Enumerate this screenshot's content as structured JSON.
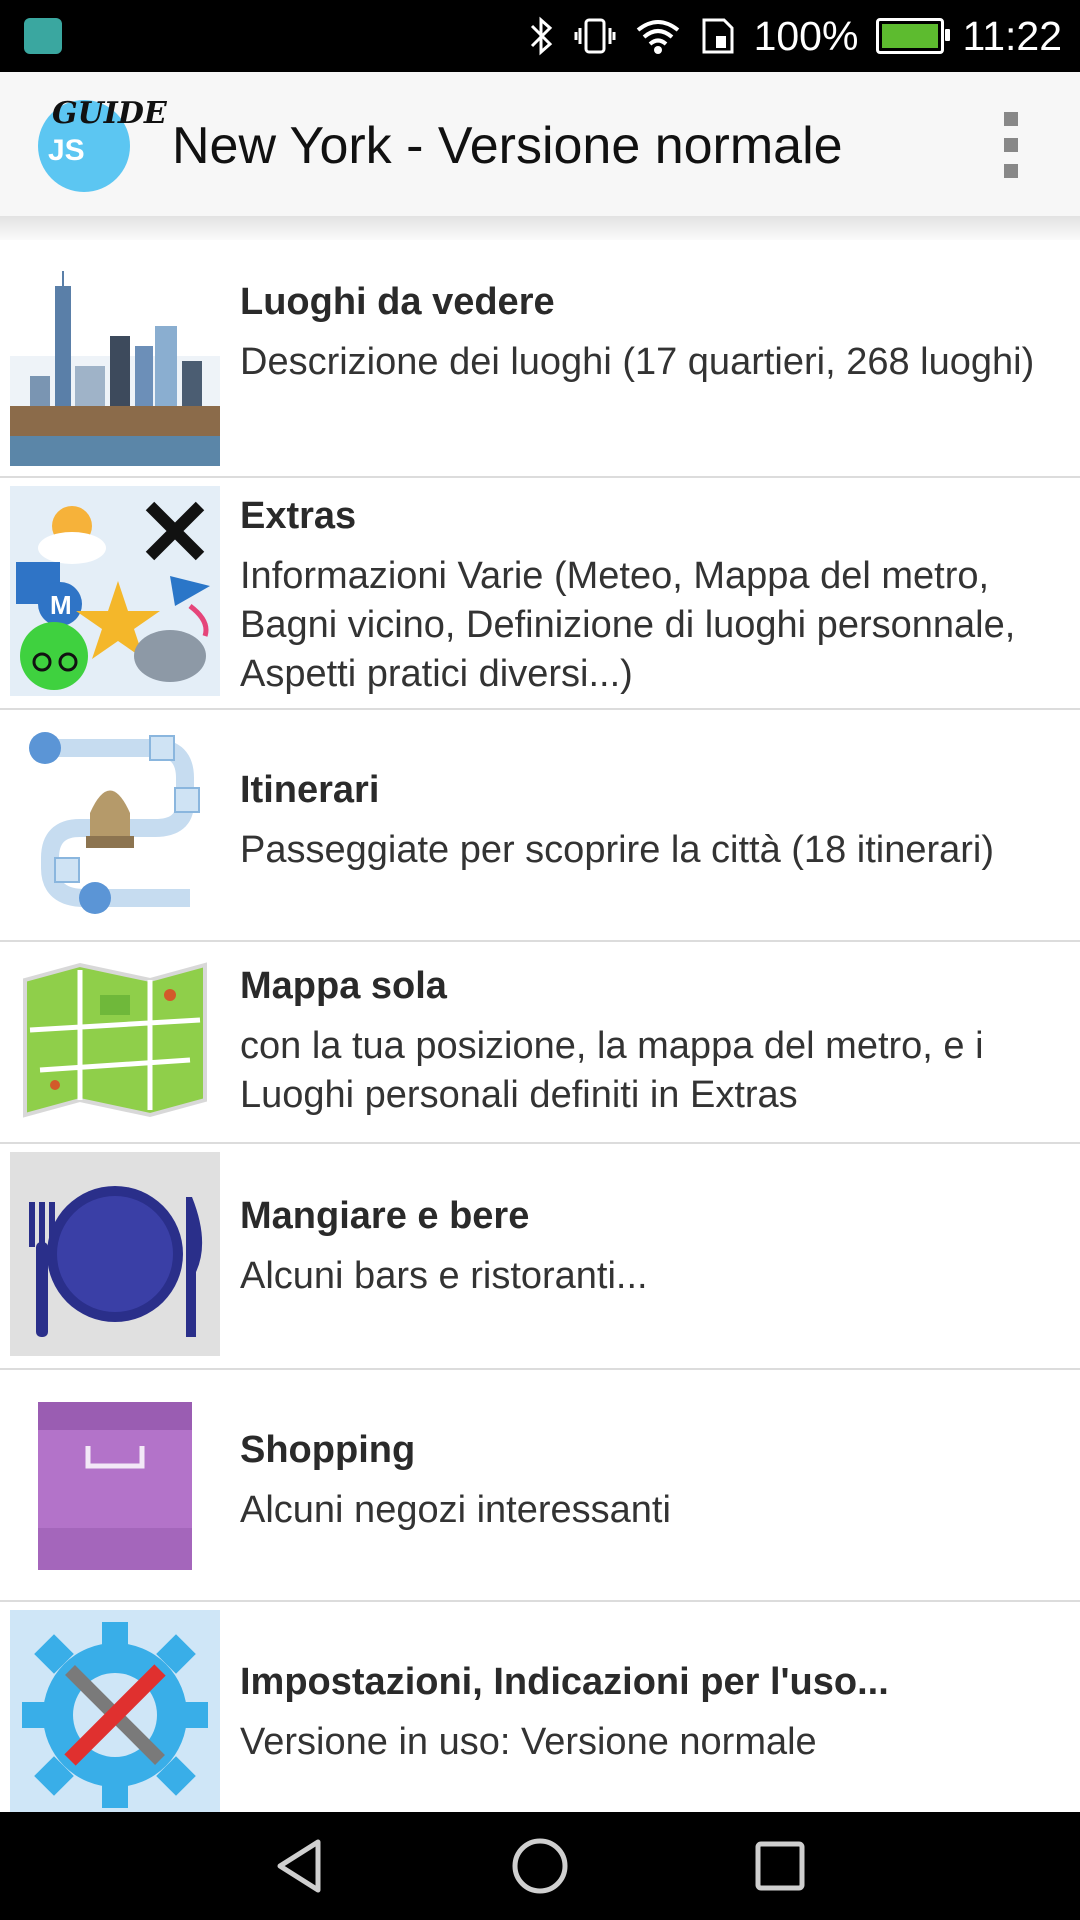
{
  "status_bar": {
    "battery": "100%",
    "time": "11:22",
    "battery_color": "#5dbb2f",
    "icons": [
      "android-icon",
      "bluetooth-icon",
      "vibrate-icon",
      "wifi-icon",
      "sim-icon",
      "battery-icon"
    ]
  },
  "app_bar": {
    "logo_top": "GUIDE",
    "logo_bottom": "JS",
    "title": "New York - Versione normale",
    "menu_icon": "overflow-menu-icon"
  },
  "items": [
    {
      "title": "Luoghi da vedere",
      "description": "Descrizione dei luoghi (17 quartieri, 268 luoghi)",
      "icon": "skyline-icon"
    },
    {
      "title": "Extras",
      "description": "Informazioni Varie (Meteo, Mappa del metro, Bagni vicino, Definizione di luoghi personnale, Aspetti pratici diversi...)",
      "icon": "extras-icon"
    },
    {
      "title": "Itinerari",
      "description": "Passeggiate per scoprire la città (18 itinerari)",
      "icon": "itinerary-icon"
    },
    {
      "title": "Mappa sola",
      "description": "con la tua posizione, la mappa del metro, e i Luoghi personali definiti in Extras",
      "icon": "map-icon"
    },
    {
      "title": "Mangiare e bere",
      "description": "Alcuni bars e ristoranti...",
      "icon": "dining-icon"
    },
    {
      "title": "Shopping",
      "description": "Alcuni negozi interessanti",
      "icon": "shopping-bag-icon"
    },
    {
      "title": "Impostazioni, Indicazioni per l'uso...",
      "description": "Versione in uso: Versione normale",
      "icon": "settings-icon"
    }
  ],
  "nav_bar": {
    "icons": [
      "back-icon",
      "home-icon",
      "recents-icon"
    ]
  }
}
